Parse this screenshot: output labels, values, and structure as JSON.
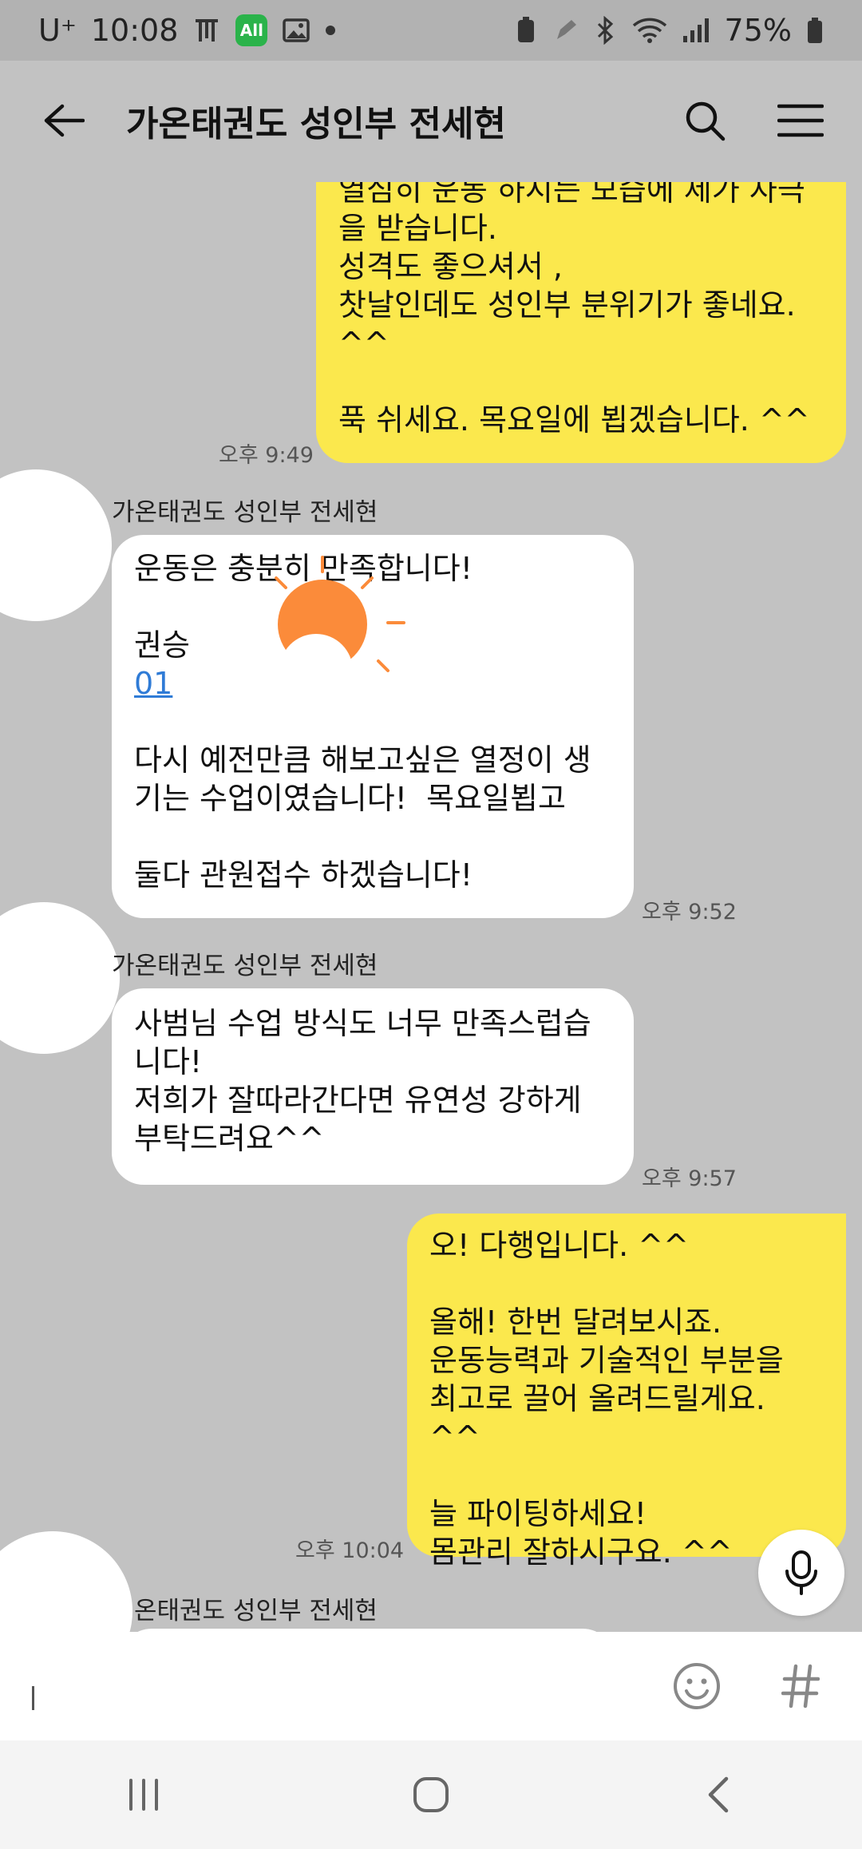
{
  "status_bar": {
    "carrier": "U⁺",
    "time": "10:08",
    "battery": "75%"
  },
  "header": {
    "title": "가온태권도 성인부 전세현"
  },
  "messages": [
    {
      "from": "me",
      "lines": "열심히 운동 하시는 모습에 제가 자극\n을 받습니다.\n성격도 좋으셔서 ,\n찻날인데도 성인부 분위기가 좋네요.\n^^\n\n푹 쉬세요. 목요일에 뵙겠습니다. ^^",
      "time": "오후 9:49"
    },
    {
      "from": "them",
      "sender": "가온태권도 성인부 전세현",
      "line1": "운동은 충분히 만족합니다!",
      "line2": "권승",
      "link": "01",
      "rest": "다시 예전만큼 해보고싶은 열정이 생\n기는 수업이였습니다!  목요일뵙고\n\n둘다 관원접수 하겠습니다!",
      "time": "오후 9:52"
    },
    {
      "from": "them",
      "sender": "가온태권도 성인부 전세현",
      "lines": "사범님 수업 방식도 너무 만족스럽습\n니다!\n저희가 잘따라간다면 유연성 강하게\n부탁드려요^^",
      "time": "오후 9:57"
    },
    {
      "from": "me",
      "lines": "오! 다행입니다. ^^\n\n올해! 한번 달려보시죠.\n운동능력과 기술적인 부분을\n최고로 끌어 올려드릴게요. ^^\n\n늘 파이팅하세요!\n몸관리 잘하시구요. ^^",
      "time": "오후 10:04"
    },
    {
      "from": "them",
      "sender": "온태권도 성인부 전세현"
    }
  ],
  "input": {
    "value": "",
    "placeholder": ""
  }
}
